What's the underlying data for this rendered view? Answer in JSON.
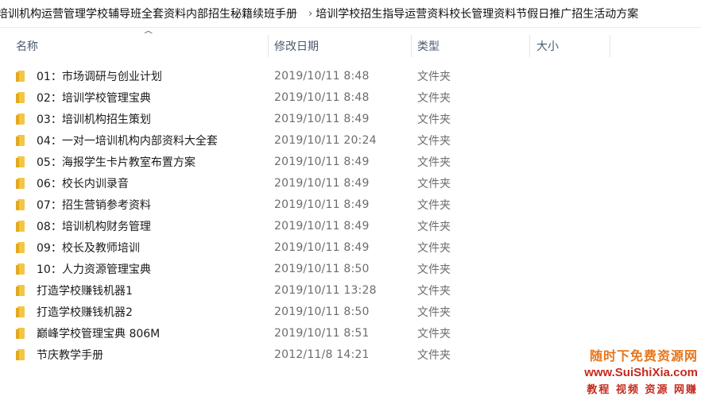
{
  "breadcrumb": [
    "培训机构运营管理学校辅导班全套资料内部招生秘籍续班手册",
    "培训学校招生指导运营资料校长管理资料节假日推广招生活动方案"
  ],
  "breadcrumb_separator": "›",
  "columns": {
    "name": "名称",
    "date": "修改日期",
    "type": "类型",
    "size": "大小"
  },
  "sort_indicator": "^",
  "rows": [
    {
      "name": "01：市场调研与创业计划",
      "date": "2019/10/11 8:48",
      "type": "文件夹"
    },
    {
      "name": "02：培训学校管理宝典",
      "date": "2019/10/11 8:48",
      "type": "文件夹"
    },
    {
      "name": "03：培训机构招生策划",
      "date": "2019/10/11 8:49",
      "type": "文件夹"
    },
    {
      "name": "04：一对一培训机构内部资料大全套",
      "date": "2019/10/11 20:24",
      "type": "文件夹"
    },
    {
      "name": "05：海报学生卡片教室布置方案",
      "date": "2019/10/11 8:49",
      "type": "文件夹"
    },
    {
      "name": "06：校长内训录音",
      "date": "2019/10/11 8:49",
      "type": "文件夹"
    },
    {
      "name": "07：招生营销参考资料",
      "date": "2019/10/11 8:49",
      "type": "文件夹"
    },
    {
      "name": "08：培训机构财务管理",
      "date": "2019/10/11 8:49",
      "type": "文件夹"
    },
    {
      "name": "09：校长及教师培训",
      "date": "2019/10/11 8:49",
      "type": "文件夹"
    },
    {
      "name": "10：人力资源管理宝典",
      "date": "2019/10/11 8:50",
      "type": "文件夹"
    },
    {
      "name": "打造学校赚钱机器1",
      "date": "2019/10/11 13:28",
      "type": "文件夹"
    },
    {
      "name": "打造学校赚钱机器2",
      "date": "2019/10/11 8:50",
      "type": "文件夹"
    },
    {
      "name": "巅峰学校管理宝典 806M",
      "date": "2019/10/11 8:51",
      "type": "文件夹"
    },
    {
      "name": "节庆教学手册",
      "date": "2012/11/8 14:21",
      "type": "文件夹"
    }
  ],
  "watermark": {
    "top": "随时下免费资源网",
    "url": "www.SuiShiXia.com",
    "bottom": "教程 视频 资源 网赚"
  },
  "colors": {
    "folder": "#f4c646",
    "header_text": "#4a5a6f",
    "watermark_orange": "#e8761b",
    "watermark_red": "#c42a1e"
  }
}
